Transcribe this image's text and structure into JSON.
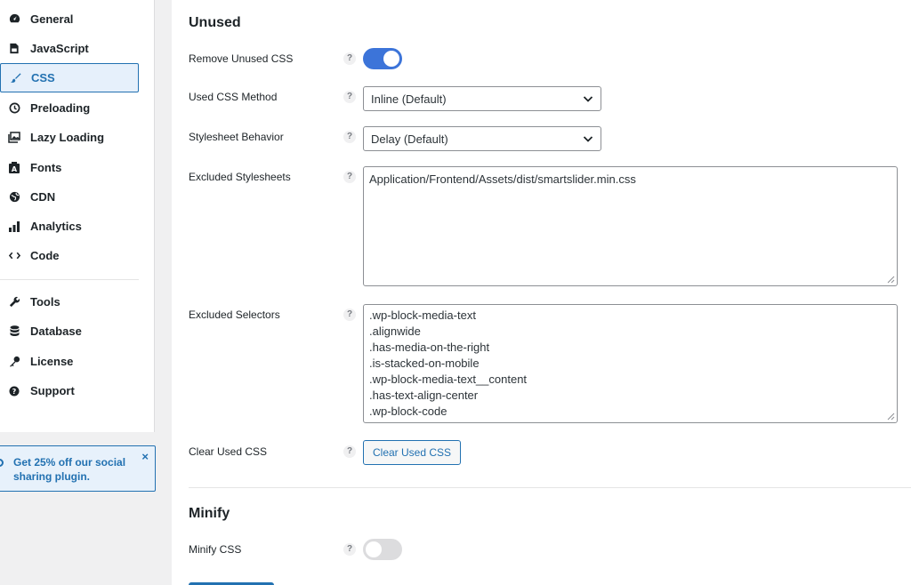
{
  "sidebar": {
    "items": [
      {
        "label": "General",
        "icon": "dashboard-icon"
      },
      {
        "label": "JavaScript",
        "icon": "js-file-icon"
      },
      {
        "label": "CSS",
        "icon": "brush-icon"
      },
      {
        "label": "Preloading",
        "icon": "clock-icon"
      },
      {
        "label": "Lazy Loading",
        "icon": "images-icon"
      },
      {
        "label": "Fonts",
        "icon": "font-box-icon"
      },
      {
        "label": "CDN",
        "icon": "globe-icon"
      },
      {
        "label": "Analytics",
        "icon": "bar-chart-icon"
      },
      {
        "label": "Code",
        "icon": "code-icon"
      },
      {
        "label": "Tools",
        "icon": "wrench-icon"
      },
      {
        "label": "Database",
        "icon": "database-icon"
      },
      {
        "label": "License",
        "icon": "key-icon"
      },
      {
        "label": "Support",
        "icon": "help-circle-icon"
      }
    ],
    "active": "CSS"
  },
  "promo": {
    "text": "Get 25% off our social sharing plugin.",
    "close": "×"
  },
  "unused": {
    "title": "Unused",
    "help": "?",
    "remove_unused_css": {
      "label": "Remove Unused CSS",
      "enabled": true
    },
    "used_css_method": {
      "label": "Used CSS Method",
      "value": "Inline (Default)"
    },
    "stylesheet_behavior": {
      "label": "Stylesheet Behavior",
      "value": "Delay (Default)"
    },
    "excluded_stylesheets": {
      "label": "Excluded Stylesheets",
      "lines": [
        "Application/Frontend/Assets/dist/smartslider.min.css"
      ]
    },
    "excluded_selectors": {
      "label": "Excluded Selectors",
      "lines": [
        ".wp-block-media-text",
        ".alignwide",
        ".has-media-on-the-right",
        ".is-stacked-on-mobile",
        ".wp-block-media-text__content",
        ".has-text-align-center",
        ".wp-block-code"
      ]
    },
    "clear_used_css": {
      "label": "Clear Used CSS",
      "button": "Clear Used CSS"
    }
  },
  "minify": {
    "title": "Minify",
    "minify_css": {
      "label": "Minify CSS",
      "enabled": false
    }
  },
  "colors": {
    "accent": "#2271b1",
    "toggle_on": "#3c74d9"
  }
}
